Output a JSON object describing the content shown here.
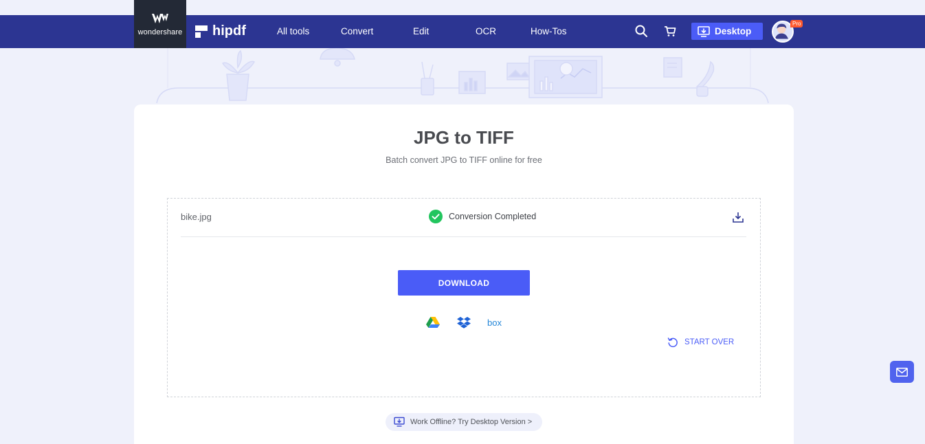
{
  "header": {
    "wondershare_label": "wondershare",
    "brand": "hipdf",
    "nav": [
      "All tools",
      "Convert",
      "Edit",
      "OCR",
      "How-Tos"
    ],
    "desktop_label": "Desktop",
    "pro_badge": "Pro",
    "icons": [
      "search-icon",
      "cart-icon",
      "desktop-download-icon",
      "avatar"
    ]
  },
  "main": {
    "title": "JPG to TIFF",
    "subtitle": "Batch convert JPG to TIFF online for free",
    "file": {
      "name": "bike.jpg",
      "status": "Conversion Completed"
    },
    "download_label": "DOWNLOAD",
    "cloud_services": [
      "google-drive-icon",
      "dropbox-icon",
      "box-icon"
    ],
    "box_label": "box",
    "start_over_label": "START OVER",
    "offline_label": "Work Offline? Try Desktop Version >"
  },
  "colors": {
    "navbar": "#2c3592",
    "accent": "#4a5cf7",
    "success": "#22c55e",
    "page_bg": "#eff1fb"
  }
}
